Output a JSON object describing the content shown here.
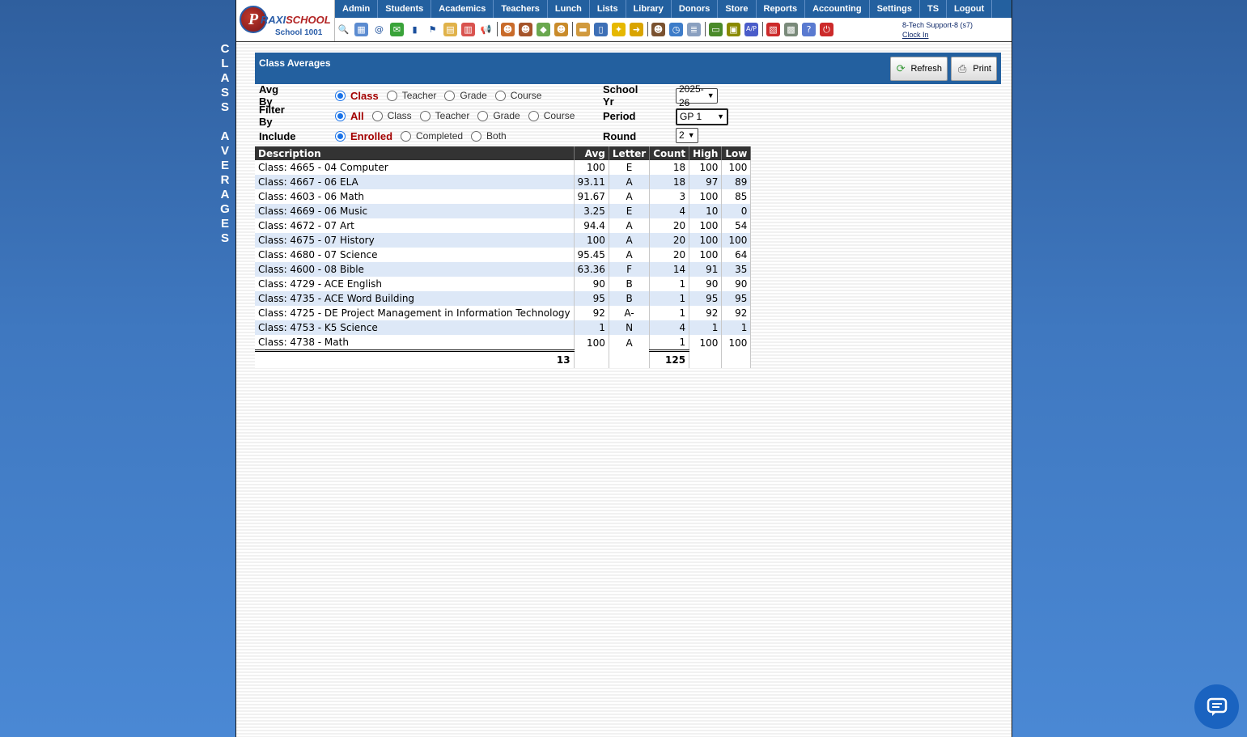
{
  "side_title": [
    "C",
    "L",
    "A",
    "S",
    "S",
    "",
    "A",
    "V",
    "E",
    "R",
    "A",
    "G",
    "E",
    "S"
  ],
  "logo": {
    "brand_praxi": "P",
    "brand_text_1": "RAXI",
    "brand_text_2": "SCHOOL",
    "school": "School 1001"
  },
  "menu": [
    "Admin",
    "Students",
    "Academics",
    "Teachers",
    "Lunch",
    "Lists",
    "Library",
    "Donors",
    "Store",
    "Reports",
    "Accounting",
    "Settings",
    "TS",
    "Logout"
  ],
  "toolbar_icons": [
    {
      "name": "search-icon",
      "glyph": "🔍",
      "color": "#ffffff"
    },
    {
      "name": "calendar-grid-icon",
      "glyph": "▦",
      "color": "#5b8bd0"
    },
    {
      "name": "email-icon",
      "glyph": "@",
      "color": "#ffffff"
    },
    {
      "name": "chat-bubble-icon",
      "glyph": "✉",
      "color": "#3aa33a"
    },
    {
      "name": "mobile-phone-icon",
      "glyph": "▮",
      "color": "#ffffff"
    },
    {
      "name": "flag-icon",
      "glyph": "⚑",
      "color": "#ffffff"
    },
    {
      "name": "report-card-icon",
      "glyph": "▤",
      "color": "#e0b24a"
    },
    {
      "name": "calendar-icon",
      "glyph": "▥",
      "color": "#d9534f"
    },
    {
      "name": "megaphone-icon",
      "glyph": "📢",
      "color": "#ffffff"
    },
    {
      "name": "student-icon",
      "glyph": "☻",
      "color": "#c96b2a"
    },
    {
      "name": "teacher-icon",
      "glyph": "☻",
      "color": "#a5542a"
    },
    {
      "name": "eraser-icon",
      "glyph": "◆",
      "color": "#6aa84f"
    },
    {
      "name": "parents-icon",
      "glyph": "☻",
      "color": "#c98b2a"
    },
    {
      "name": "lunch-icon",
      "glyph": "▬",
      "color": "#d19a3e"
    },
    {
      "name": "book-icon",
      "glyph": "▯",
      "color": "#3d6fb6"
    },
    {
      "name": "cleanup-icon",
      "glyph": "✦",
      "color": "#e6b800"
    },
    {
      "name": "folder-arrow-icon",
      "glyph": "➜",
      "color": "#d9a400"
    },
    {
      "name": "staff-icon",
      "glyph": "☻",
      "color": "#7a5230"
    },
    {
      "name": "clock-icon",
      "glyph": "◷",
      "color": "#3d7cc9"
    },
    {
      "name": "list-icon",
      "glyph": "≣",
      "color": "#8aa0c0"
    },
    {
      "name": "money-icon",
      "glyph": "▭",
      "color": "#4a8a2a"
    },
    {
      "name": "printer-icon",
      "glyph": "▣",
      "color": "#8a8a00"
    },
    {
      "name": "accounts-payable-icon",
      "glyph": "A/P",
      "color": "#4a5cc9"
    },
    {
      "name": "pdf-icon",
      "glyph": "▧",
      "color": "#cc2a2a"
    },
    {
      "name": "cash-register-icon",
      "glyph": "▩",
      "color": "#7a8a7a"
    },
    {
      "name": "help-icon",
      "glyph": "?",
      "color": "#5a7ad0"
    },
    {
      "name": "power-icon",
      "glyph": "⏻",
      "color": "#cc2a2a"
    }
  ],
  "user": {
    "name": "8-Tech Support-8 (s7)",
    "clock_in": "Clock In"
  },
  "page_title": "Class Averages",
  "buttons": {
    "refresh": "Refresh",
    "print": "Print"
  },
  "form": {
    "avg_by": {
      "label": "Avg By",
      "options": [
        "Class",
        "Teacher",
        "Grade",
        "Course"
      ],
      "selected": "Class"
    },
    "filter_by": {
      "label": "Filter By",
      "options": [
        "All",
        "Class",
        "Teacher",
        "Grade",
        "Course"
      ],
      "selected": "All"
    },
    "include": {
      "label": "Include",
      "options": [
        "Enrolled",
        "Completed",
        "Both"
      ],
      "selected": "Enrolled"
    },
    "school_yr": {
      "label": "School Yr",
      "value": "2025-26"
    },
    "period": {
      "label": "Period",
      "value": "GP 1"
    },
    "round": {
      "label": "Round",
      "value": "2"
    }
  },
  "table": {
    "headers": [
      "Description",
      "Avg",
      "Letter",
      "Count",
      "High",
      "Low"
    ],
    "rows": [
      [
        "Class: 4665 - 04 Computer",
        "100",
        "E",
        "18",
        "100",
        "100"
      ],
      [
        "Class: 4667 - 06 ELA",
        "93.11",
        "A",
        "18",
        "97",
        "89"
      ],
      [
        "Class: 4603 - 06 Math",
        "91.67",
        "A",
        "3",
        "100",
        "85"
      ],
      [
        "Class: 4669 - 06 Music",
        "3.25",
        "E",
        "4",
        "10",
        "0"
      ],
      [
        "Class: 4672 - 07 Art",
        "94.4",
        "A",
        "20",
        "100",
        "54"
      ],
      [
        "Class: 4675 - 07 History",
        "100",
        "A",
        "20",
        "100",
        "100"
      ],
      [
        "Class: 4680 - 07 Science",
        "95.45",
        "A",
        "20",
        "100",
        "64"
      ],
      [
        "Class: 4600 - 08 Bible",
        "63.36",
        "F",
        "14",
        "91",
        "35"
      ],
      [
        "Class: 4729 - ACE English",
        "90",
        "B",
        "1",
        "90",
        "90"
      ],
      [
        "Class: 4735 - ACE Word Building",
        "95",
        "B",
        "1",
        "95",
        "95"
      ],
      [
        "Class: 4725 - DE Project Management in Information Technology",
        "92",
        "A-",
        "1",
        "92",
        "92"
      ],
      [
        "Class: 4753 - K5 Science",
        "1",
        "N",
        "4",
        "1",
        "1"
      ],
      [
        "Class: 4738 - Math",
        "100",
        "A",
        "1",
        "100",
        "100"
      ]
    ],
    "totals": {
      "description_count": "13",
      "count_total": "125"
    }
  },
  "colors": {
    "menu_bg": "#23609f",
    "selected_option": "#a30000",
    "row_alt": "#dde8f7",
    "header_bg": "#333333",
    "chat_button": "#1a63c0"
  }
}
